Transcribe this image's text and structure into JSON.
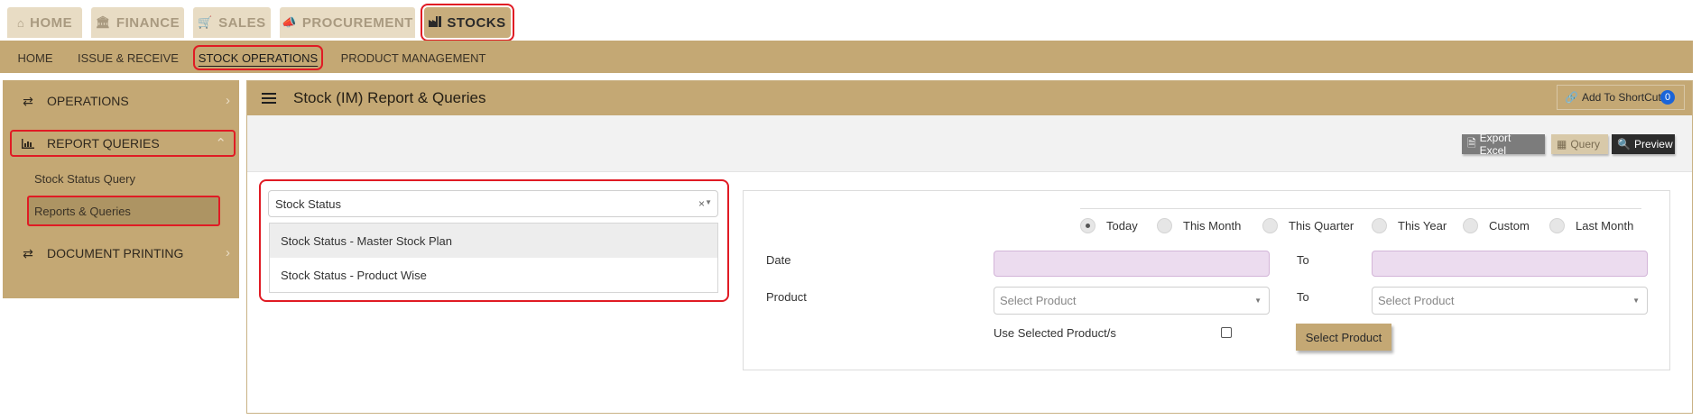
{
  "top_tabs": [
    {
      "label": "HOME",
      "icon": "home-icon"
    },
    {
      "label": "FINANCE",
      "icon": "bank-icon"
    },
    {
      "label": "SALES",
      "icon": "cart-icon"
    },
    {
      "label": "PROCUREMENT",
      "icon": "bullhorn-icon"
    },
    {
      "label": "STOCKS",
      "icon": "industry-icon",
      "active": true
    }
  ],
  "submenu": [
    {
      "label": "HOME"
    },
    {
      "label": "ISSUE & RECEIVE"
    },
    {
      "label": "STOCK OPERATIONS",
      "active": true
    },
    {
      "label": "PRODUCT MANAGEMENT"
    }
  ],
  "sidebar": {
    "items": [
      {
        "label": "OPERATIONS",
        "icon": "exchange-icon"
      },
      {
        "label": "REPORT QUERIES",
        "icon": "bar-chart-icon",
        "expanded": true
      },
      {
        "label": "DOCUMENT PRINTING",
        "icon": "exchange-icon"
      }
    ],
    "sub_items": [
      {
        "label": "Stock Status Query"
      },
      {
        "label": "Reports & Queries",
        "selected": true
      }
    ]
  },
  "panel": {
    "title": "Stock (IM) Report & Queries",
    "shortcut_label": "Add To ShortCut",
    "shortcut_count": "0",
    "toolbar": {
      "export_label": "Export Excel",
      "query_label": "Query",
      "preview_label": "Preview"
    }
  },
  "report_select": {
    "value": "Stock Status",
    "clear_glyph": "×",
    "options": [
      "Stock Status - Master Stock Plan",
      "Stock Status - Product Wise"
    ]
  },
  "filters": {
    "periods": [
      {
        "label": "Today",
        "checked": true
      },
      {
        "label": "This Month"
      },
      {
        "label": "This Quarter"
      },
      {
        "label": "This Year"
      },
      {
        "label": "Custom"
      },
      {
        "label": "Last Month"
      }
    ],
    "date_label": "Date",
    "to_label": "To",
    "product_label": "Product",
    "product_from_placeholder": "Select Product",
    "product_to_placeholder": "Select Product",
    "use_selected_label": "Use Selected Product/s",
    "select_product_button": "Select Product"
  },
  "colors": {
    "brand": "#c4a874",
    "highlight": "#e01b24",
    "badge": "#1a64d8"
  }
}
